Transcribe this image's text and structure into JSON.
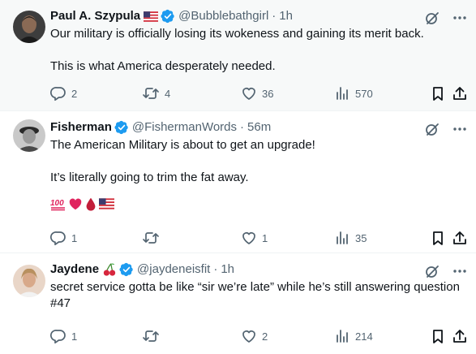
{
  "tweets": [
    {
      "name": "Paul A. Szypula",
      "handle": "@Bubblebathgirl",
      "dot": "·",
      "time": "1h",
      "text": "Our military is officially losing its wokeness and gaining its merit back.\n\nThis is what America desperately needed.",
      "replies": "2",
      "retweets": "4",
      "likes": "36",
      "views": "570"
    },
    {
      "name": "Fisherman",
      "handle": "@FishermanWords",
      "dot": "·",
      "time": "56m",
      "text": "The American Military is about to get an upgrade!\n\nIt’s literally going to trim the fat away.",
      "replies": "1",
      "retweets": "",
      "likes": "1",
      "views": "35"
    },
    {
      "name": "Jaydene",
      "handle": "@jaydeneisfit",
      "dot": "·",
      "time": "1h",
      "text": "secret service gotta be like “sir we’re late” while he’s still answering question #47",
      "replies": "1",
      "retweets": "",
      "likes": "2",
      "views": "214"
    }
  ],
  "colors": {
    "verified": "#1d9bf0",
    "secondary_text": "#536471",
    "hovered_background": "#f7f9f9"
  }
}
